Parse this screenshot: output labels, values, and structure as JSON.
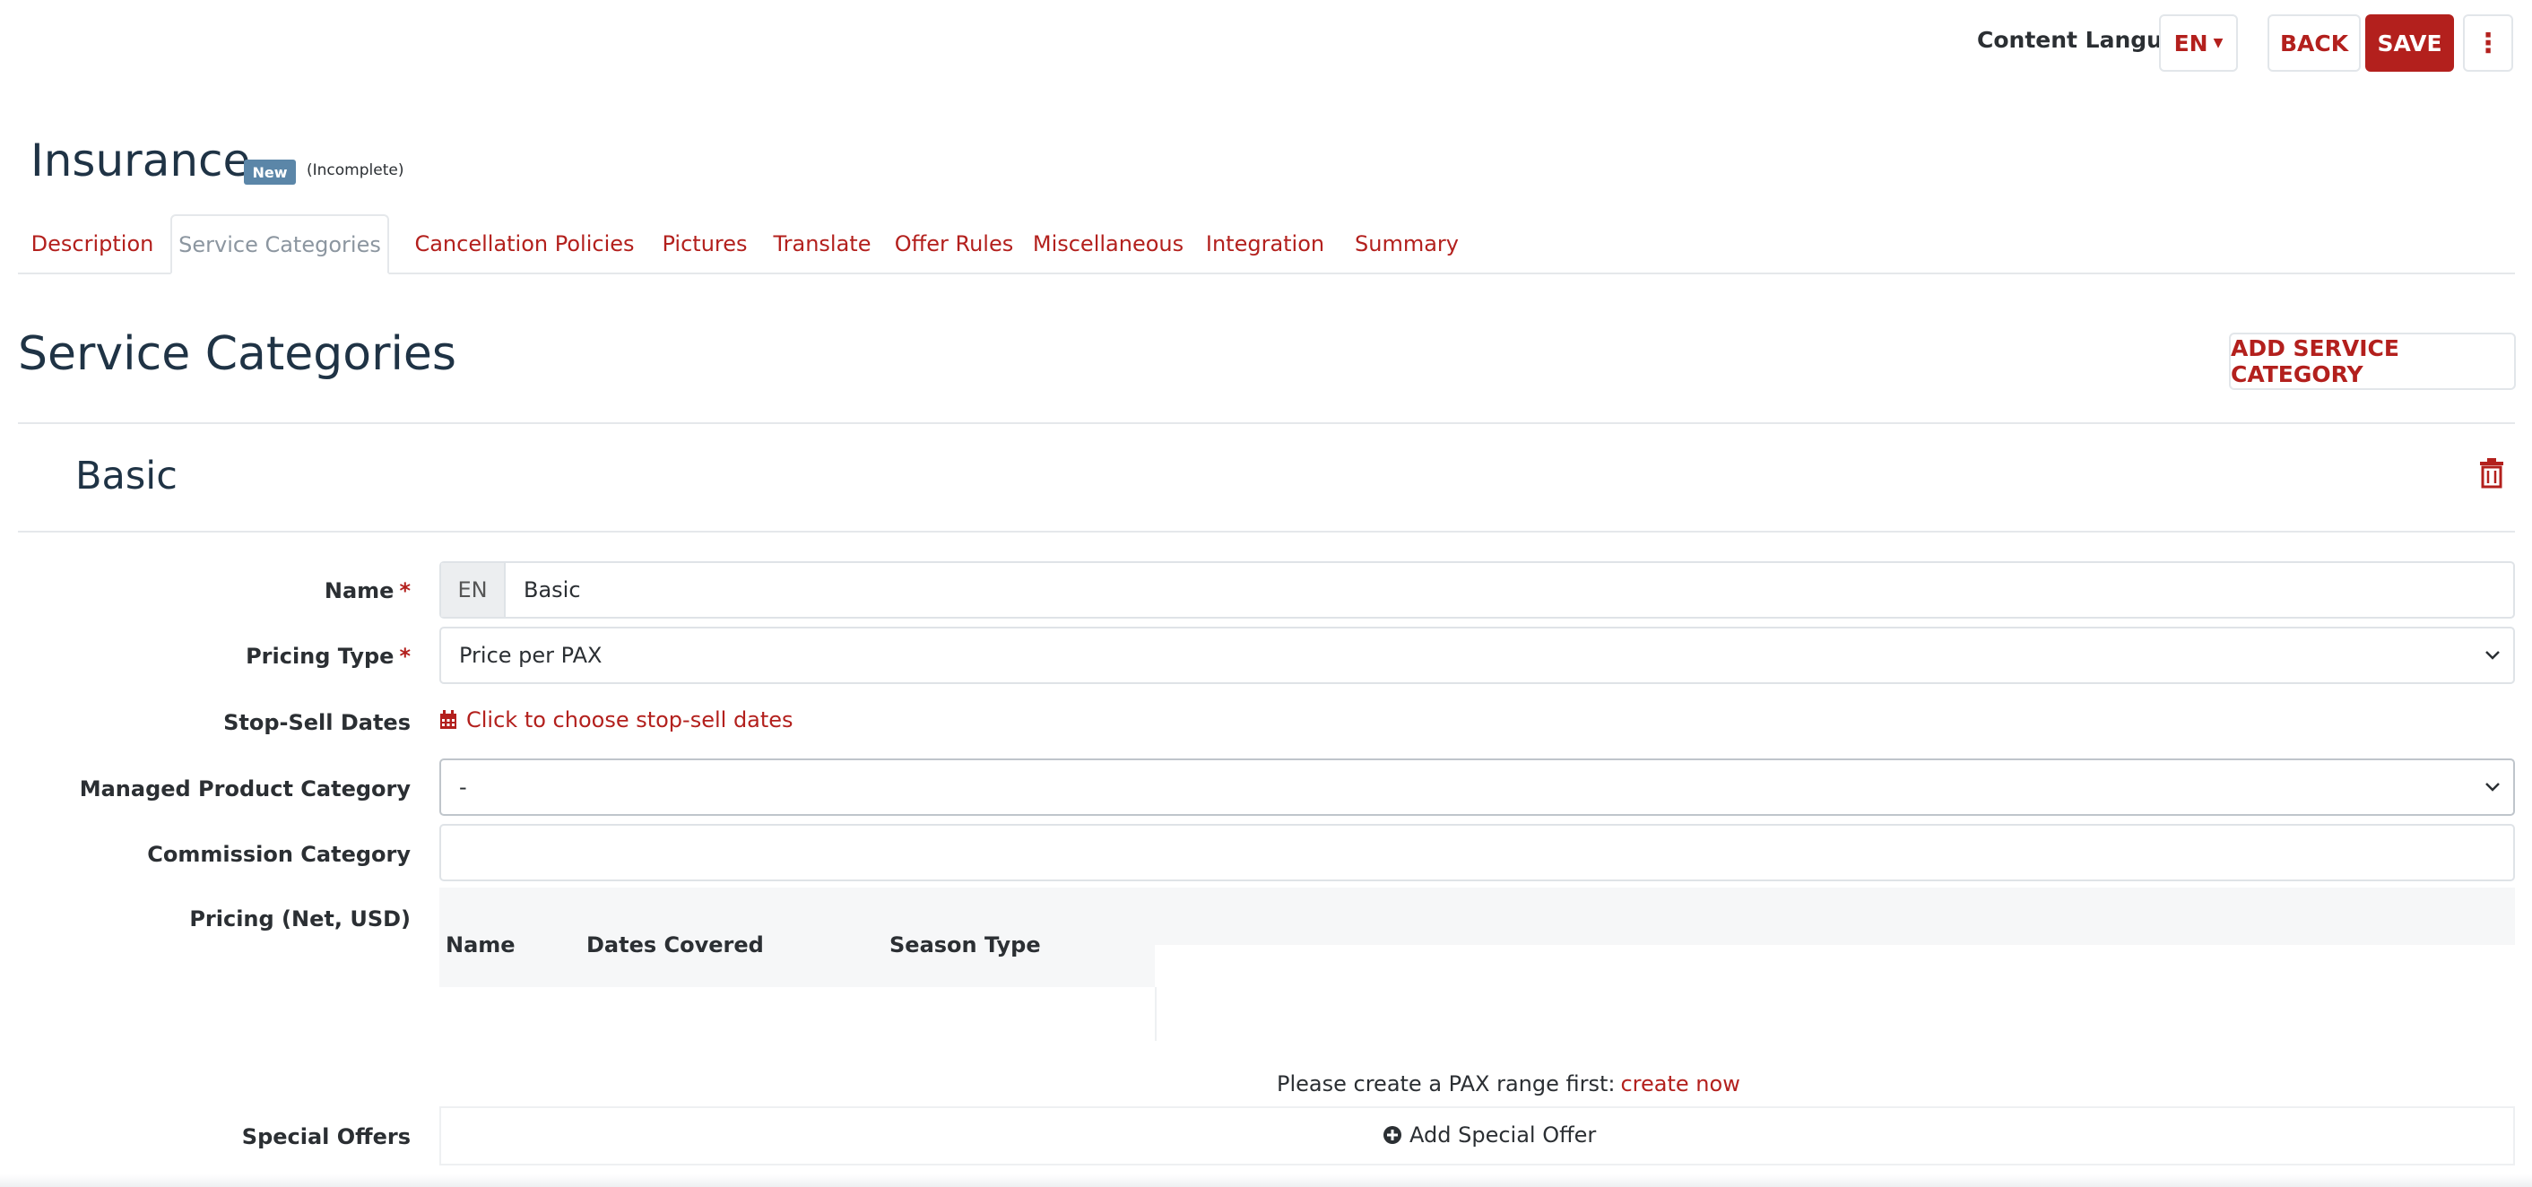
{
  "header": {
    "content_language_label": "Content Language",
    "language_value": "EN",
    "back_label": "BACK",
    "save_label": "SAVE",
    "more_icon": "vertical-ellipsis"
  },
  "product": {
    "title": "Insurance",
    "badge": "New",
    "status": "(Incomplete)"
  },
  "tabs": [
    {
      "label": "Description"
    },
    {
      "label": "Service Categories"
    },
    {
      "label": "Cancellation Policies"
    },
    {
      "label": "Pictures"
    },
    {
      "label": "Translate"
    },
    {
      "label": "Offer Rules"
    },
    {
      "label": "Miscellaneous"
    },
    {
      "label": "Integration"
    },
    {
      "label": "Summary"
    }
  ],
  "active_tab": "Service Categories",
  "section": {
    "title": "Service Categories",
    "add_button": "ADD SERVICE CATEGORY"
  },
  "category": {
    "title": "Basic",
    "delete_icon": "trash-icon"
  },
  "form": {
    "name_label": "Name",
    "name_lang": "EN",
    "name_value": "Basic",
    "pricing_type_label": "Pricing Type",
    "pricing_type_value": "Price per PAX",
    "stop_sell_label": "Stop-Sell Dates",
    "stop_sell_link": "Click to choose stop-sell dates",
    "managed_category_label": "Managed Product Category",
    "managed_category_value": "-",
    "commission_label": "Commission Category",
    "commission_value": "",
    "pricing_label": "Pricing (Net, USD)",
    "required_mark": "*"
  },
  "pricing_table": {
    "columns": [
      "Name",
      "Dates Covered",
      "Season Type"
    ]
  },
  "pax": {
    "message": "Please create a PAX range first:",
    "link": "create now"
  },
  "special_offers": {
    "label": "Special Offers",
    "add_label": "Add Special Offer"
  },
  "colors": {
    "accent": "#b3201d",
    "heading": "#1f3345",
    "badge": "#5b86a8"
  }
}
